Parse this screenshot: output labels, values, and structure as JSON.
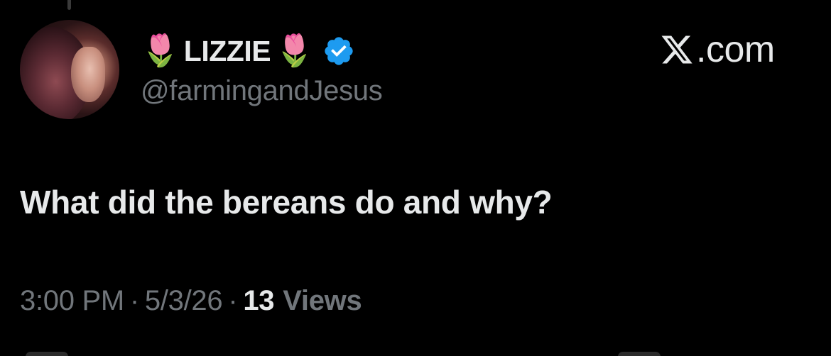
{
  "author": {
    "name_prefix_emoji": "🌷",
    "name": "LIZZIE",
    "name_suffix_emoji": "🌷",
    "verified": true,
    "verified_color": "#1d9bf0",
    "handle": "@farmingandJesus"
  },
  "brand": {
    "icon": "x-logo-icon",
    "label": ".com"
  },
  "tweet": {
    "text": "What did the bereans do and why?"
  },
  "meta": {
    "time": "3:00 PM",
    "separator": "·",
    "date": "5/3/26",
    "views_count": "13",
    "views_label": "Views"
  },
  "colors": {
    "background": "#000000",
    "primary_text": "#e7e9ea",
    "secondary_text": "#71767b"
  }
}
